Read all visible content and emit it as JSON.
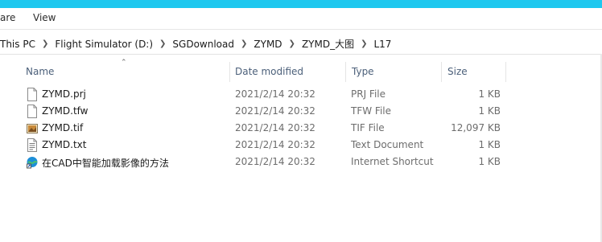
{
  "ribbon": {
    "tabs": [
      "are",
      "View"
    ]
  },
  "address": {
    "crumbs": [
      "This PC",
      "Flight Simulator (D:)",
      "SGDownload",
      "ZYMD",
      "ZYMD_大图",
      "L17"
    ]
  },
  "columns": {
    "name": "Name",
    "date": "Date modified",
    "type": "Type",
    "size": "Size"
  },
  "files": [
    {
      "name": "ZYMD.prj",
      "date": "2021/2/14 20:32",
      "type": "PRJ File",
      "size": "1 KB",
      "icon": "blank-file-icon"
    },
    {
      "name": "ZYMD.tfw",
      "date": "2021/2/14 20:32",
      "type": "TFW File",
      "size": "1 KB",
      "icon": "blank-file-icon"
    },
    {
      "name": "ZYMD.tif",
      "date": "2021/2/14 20:32",
      "type": "TIF File",
      "size": "12,097 KB",
      "icon": "image-file-icon"
    },
    {
      "name": "ZYMD.txt",
      "date": "2021/2/14 20:32",
      "type": "Text Document",
      "size": "1 KB",
      "icon": "text-file-icon"
    },
    {
      "name": "在CAD中智能加载影像的方法",
      "date": "2021/2/14 20:32",
      "type": "Internet Shortcut",
      "size": "1 KB",
      "icon": "internet-shortcut-icon"
    }
  ],
  "colors": {
    "titlebar": "#1ec8ef",
    "header_text": "#4c607a"
  }
}
